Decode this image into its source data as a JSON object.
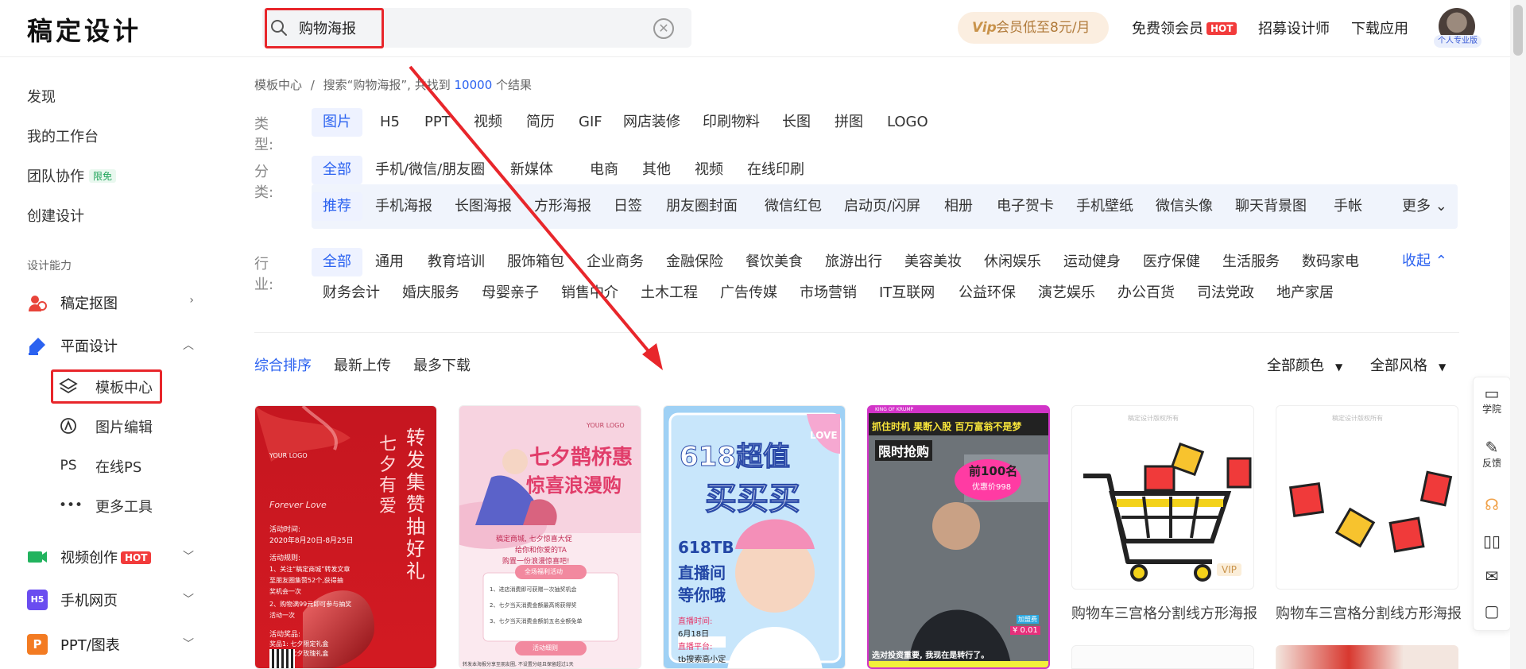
{
  "header": {
    "logo": "稿定设计",
    "search_value": "购物海报",
    "clear_icon": "clear-circle-icon",
    "vip_badge": "会员低至8元/月",
    "vip_icon_text": "Vip",
    "free_vip": "免费领会员",
    "hot": "HOT",
    "recruit": "招募设计师",
    "download_app": "下载应用",
    "avatar_tag": "个人专业版"
  },
  "sidebar": {
    "links": [
      "发现",
      "我的工作台",
      "团队协作",
      "创建设计"
    ],
    "team_badge": "限免",
    "section_title": "设计能力",
    "items": [
      {
        "label": "稿定抠图",
        "icon": "cutout-icon",
        "color": "#e8443a"
      },
      {
        "label": "平面设计",
        "icon": "design-brush-icon",
        "color": "#2b62f0"
      },
      {
        "label": "视频创作",
        "icon": "video-icon",
        "color": "#22b35e"
      },
      {
        "label": "手机网页",
        "icon": "h5-icon",
        "color": "#6a4cf0"
      },
      {
        "label": "PPT/图表",
        "icon": "ppt-icon",
        "color": "#f37b22"
      }
    ],
    "sub_items": [
      "模板中心",
      "图片编辑",
      "在线PS",
      "更多工具"
    ],
    "ps_glyph": "PS",
    "h5_glyph": "H5",
    "ppt_glyph": "P"
  },
  "breadcrumb": {
    "root": "模板中心",
    "separator": "/",
    "prefix": "搜索“购物海报”, 共找到",
    "count": "10000",
    "suffix": "个结果"
  },
  "filters": {
    "type_label": "类型:",
    "types": [
      "图片",
      "H5",
      "PPT",
      "视频",
      "简历",
      "GIF",
      "网店装修",
      "印刷物料",
      "长图",
      "拼图",
      "LOGO"
    ],
    "category_label": "分类:",
    "categories": [
      "全部",
      "手机/微信/朋友圈",
      "新媒体",
      "电商",
      "其他",
      "视频",
      "在线印刷"
    ],
    "subcategories": [
      "推荐",
      "手机海报",
      "长图海报",
      "方形海报",
      "日签",
      "朋友圈封面",
      "微信红包",
      "启动页/闪屏",
      "相册",
      "电子贺卡",
      "手机壁纸",
      "微信头像",
      "聊天背景图",
      "手帐"
    ],
    "more": "更多",
    "industry_label": "行业:",
    "industries_row1": [
      "全部",
      "通用",
      "教育培训",
      "服饰箱包",
      "企业商务",
      "金融保险",
      "餐饮美食",
      "旅游出行",
      "美容美妆",
      "休闲娱乐",
      "运动健身",
      "医疗保健",
      "生活服务",
      "数码家电"
    ],
    "industries_row2": [
      "财务会计",
      "婚庆服务",
      "母婴亲子",
      "销售中介",
      "土木工程",
      "广告传媒",
      "市场营销",
      "IT互联网",
      "公益环保",
      "演艺娱乐",
      "办公百货",
      "司法党政",
      "地产家居"
    ],
    "collapse": "收起"
  },
  "sort": {
    "options": [
      "综合排序",
      "最新上传",
      "最多下载"
    ],
    "color_filter": "全部颜色",
    "style_filter": "全部风格"
  },
  "cards": {
    "c1": {
      "title_vertical": "七夕有爱",
      "title_vertical2": "转发集赞抽好礼",
      "logo": "YOUR LOGO",
      "script_text": "Forever Love",
      "time_label": "活动时间:",
      "time_value": "2020年8月20日-8月25日",
      "rules_label": "活动规则:",
      "rule1": "1、关注“稿定商城”转发文章",
      "rule2": "至朋友圈集赞52个,获得抽",
      "rule3": "奖机会一次",
      "rule4": "2、购物满99元即可参与抽奖",
      "rule5": "活动一次",
      "prize_label": "活动奖品:",
      "prize1": "奖品1: 七夕限定礼盒",
      "prize2": "奖品2: 七夕玫瑰礼盒"
    },
    "c2": {
      "logo": "YOUR LOGO",
      "title1": "七夕鹊桥惠",
      "title2": "惊喜浪漫购",
      "sub1": "稿定商城, 七夕惊喜大促",
      "sub2": "给你和你爱的TA",
      "sub3": "购置一份浪漫惊喜吧!",
      "section1": "全场福利活动",
      "item1": "1、进店消费即可获赠一次抽奖机会",
      "item2": "2、七夕当天消费金额最高将获得奖",
      "item3": "3、七夕当天消费金额前五名全额免单",
      "section2": "活动细则",
      "footer": "转发本海报分享至朋友圈, 不设置分组且保留超过1天"
    },
    "c3": {
      "title1": "618超值",
      "title2": "买买买",
      "love": "LOVE",
      "line1": "618TB",
      "line2": "直播间",
      "line3": "等你哦",
      "time_label": "直播时间:",
      "date": "6月18日",
      "addr_label": "直播平台:",
      "search": "tb搜索高小定"
    },
    "c4": {
      "brand": "KING OF KRUMP",
      "headline": "抓住时机 果断入股 百万富翁不是梦",
      "tag": "限时抢购",
      "badge1": "前100名",
      "badge2": "优惠价998",
      "price_label": "加盟费",
      "price": "¥ 0.01",
      "bottom": "选对投资重要, 我现在是转行了。"
    },
    "c5": {
      "watermark": "稿定设计版权所有",
      "vip": "VIP",
      "title": "购物车三宫格分割线方形海报"
    },
    "c6": {
      "watermark": "稿定设计版权所有",
      "title": "购物车三宫格分割线方形海报"
    }
  },
  "float_panel": {
    "items": [
      {
        "label": "学院",
        "icon": "academy-icon"
      },
      {
        "label": "反馈",
        "icon": "feedback-icon"
      }
    ]
  },
  "colors": {
    "accent": "#2b62f0",
    "annotation_red": "#e8262b",
    "hot": "#f23b3b"
  }
}
